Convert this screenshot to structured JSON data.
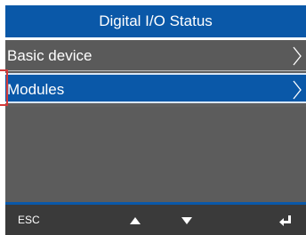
{
  "header": {
    "title": "Digital I/O Status"
  },
  "menu": {
    "items": [
      {
        "label": "Basic device",
        "selected": false
      },
      {
        "label": "Modules",
        "selected": true
      }
    ]
  },
  "softkeys": {
    "esc_label": "ESC",
    "up_icon": "triangle-up",
    "down_icon": "triangle-down",
    "enter_icon": "enter-return"
  },
  "colors": {
    "accent": "#0a58a8",
    "screen_background": "#5f5f5f",
    "softkey_background": "#3a3a3a",
    "highlight_frame": "#d43a3a"
  }
}
